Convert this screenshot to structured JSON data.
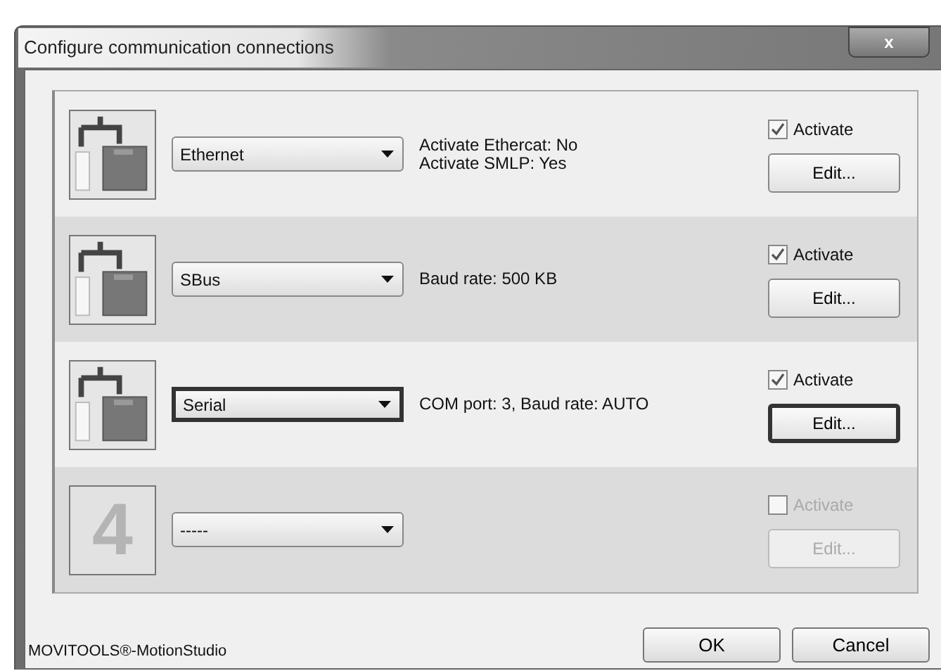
{
  "window": {
    "title": "Configure communication connections",
    "close_label": "x"
  },
  "connections": [
    {
      "kind": "connection",
      "protocol": "Ethernet",
      "description": [
        "Activate Ethercat: No",
        "Activate SMLP: Yes"
      ],
      "activate_label": "Activate",
      "checked": true,
      "disabled": false,
      "focused": false,
      "edit_label": "Edit..."
    },
    {
      "kind": "connection",
      "protocol": "SBus",
      "description": [
        "Baud rate: 500 KB"
      ],
      "activate_label": "Activate",
      "checked": true,
      "disabled": false,
      "focused": false,
      "edit_label": "Edit..."
    },
    {
      "kind": "connection",
      "protocol": "Serial",
      "description": [
        "COM port: 3, Baud rate: AUTO"
      ],
      "activate_label": "Activate",
      "checked": true,
      "disabled": false,
      "focused": true,
      "edit_label": "Edit..."
    },
    {
      "kind": "empty",
      "number": "4",
      "protocol": "-----",
      "activate_label": "Activate",
      "checked": false,
      "disabled": true,
      "focused": false,
      "edit_label": "Edit..."
    }
  ],
  "status_text": "MOVITOOLS®-MotionStudio",
  "buttons": [
    "OK",
    "Cancel"
  ]
}
